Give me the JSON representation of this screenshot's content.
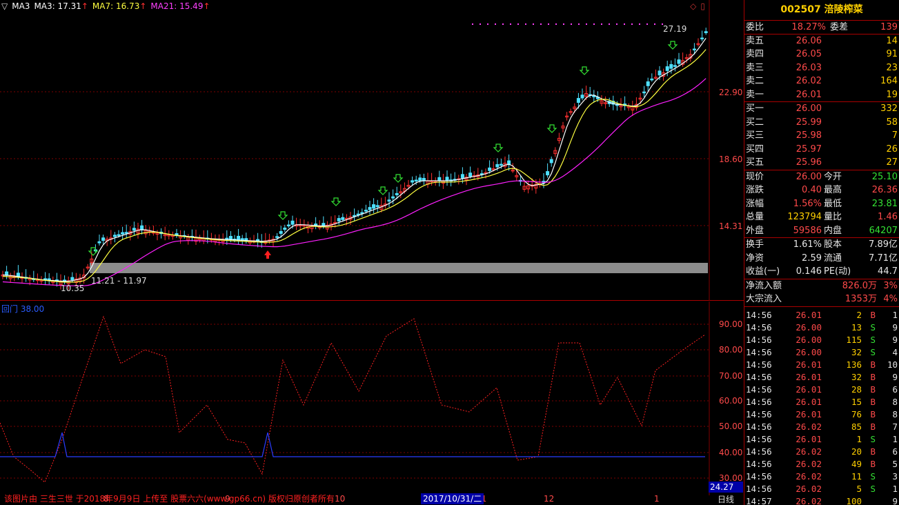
{
  "main": {
    "legend": {
      "ma3": "MA3: 17.31",
      "ma3_name": "MA3",
      "ma7": "MA7: 16.73",
      "ma21": "MA21: 15.49",
      "arrow": "↑"
    },
    "y_labels": [
      "22.90",
      "18.60",
      "14.31"
    ],
    "high_label": "27.19",
    "low_label": "10.35",
    "range_label": "11.21 - 11.97",
    "colors": {
      "up": "#ff3030",
      "down": "#4ee0ff",
      "ma3": "#ffffff",
      "ma7": "#ffff40",
      "ma21": "#ff20ff",
      "grid": "#800000"
    }
  },
  "indicator": {
    "legend": "回门 38.00",
    "y_labels": [
      "90.00",
      "80.00",
      "70.00",
      "60.00",
      "50.00",
      "40.00",
      "30.00"
    ],
    "value_box": "24.27"
  },
  "bottom": {
    "watermark": "该图片由 三生三世 于2018年9月9日 上传至 股票六六(www.gp66.cn) 版权归原创者所有",
    "date_box": "2017/10/31/二",
    "month_ticks": [
      "8",
      "9",
      "10",
      "11",
      "12",
      "1"
    ],
    "period": "日线"
  },
  "side": {
    "code": "002507",
    "name": "涪陵榨菜",
    "ratio_label": "委比",
    "ratio_value": "18.27%",
    "diff_label": "委差",
    "diff_value": "139",
    "sells": [
      {
        "label": "卖五",
        "price": "26.06",
        "vol": "14"
      },
      {
        "label": "卖四",
        "price": "26.05",
        "vol": "91"
      },
      {
        "label": "卖三",
        "price": "26.03",
        "vol": "23"
      },
      {
        "label": "卖二",
        "price": "26.02",
        "vol": "164"
      },
      {
        "label": "卖一",
        "price": "26.01",
        "vol": "19"
      }
    ],
    "buys": [
      {
        "label": "买一",
        "price": "26.00",
        "vol": "332"
      },
      {
        "label": "买二",
        "price": "25.99",
        "vol": "58"
      },
      {
        "label": "买三",
        "price": "25.98",
        "vol": "7"
      },
      {
        "label": "买四",
        "price": "25.97",
        "vol": "26"
      },
      {
        "label": "买五",
        "price": "25.96",
        "vol": "27"
      }
    ],
    "stats1": [
      {
        "l1": "现价",
        "v1": "26.00",
        "c1": "red",
        "l2": "今开",
        "v2": "25.10",
        "c2": "green"
      },
      {
        "l1": "涨跌",
        "v1": "0.40",
        "c1": "red",
        "l2": "最高",
        "v2": "26.36",
        "c2": "red"
      },
      {
        "l1": "涨幅",
        "v1": "1.56%",
        "c1": "red",
        "l2": "最低",
        "v2": "23.81",
        "c2": "green"
      },
      {
        "l1": "总量",
        "v1": "123794",
        "c1": "yellow",
        "l2": "量比",
        "v2": "1.46",
        "c2": "red"
      },
      {
        "l1": "外盘",
        "v1": "59586",
        "c1": "red",
        "l2": "内盘",
        "v2": "64207",
        "c2": "green"
      }
    ],
    "stats2": [
      {
        "l1": "换手",
        "v1": "1.61%",
        "c1": "white",
        "l2": "股本",
        "v2": "7.89亿",
        "c2": "white"
      },
      {
        "l1": "净资",
        "v1": "2.59",
        "c1": "white",
        "l2": "流通",
        "v2": "7.71亿",
        "c2": "white"
      },
      {
        "l1": "收益(一)",
        "v1": "0.146",
        "c1": "white",
        "l2": "PE(动)",
        "v2": "44.7",
        "c2": "white"
      }
    ],
    "flows": [
      {
        "label": "净流入额",
        "value": "826.0万",
        "pct": "3%"
      },
      {
        "label": "大宗流入",
        "value": "1353万",
        "pct": "4%"
      }
    ],
    "trades": [
      {
        "t": "14:56",
        "p": "26.01",
        "v": "2",
        "bs": "B",
        "n": "1"
      },
      {
        "t": "14:56",
        "p": "26.00",
        "v": "13",
        "bs": "S",
        "n": "9"
      },
      {
        "t": "14:56",
        "p": "26.00",
        "v": "115",
        "bs": "S",
        "n": "9"
      },
      {
        "t": "14:56",
        "p": "26.00",
        "v": "32",
        "bs": "S",
        "n": "4"
      },
      {
        "t": "14:56",
        "p": "26.01",
        "v": "136",
        "bs": "B",
        "n": "10"
      },
      {
        "t": "14:56",
        "p": "26.01",
        "v": "32",
        "bs": "B",
        "n": "9"
      },
      {
        "t": "14:56",
        "p": "26.01",
        "v": "28",
        "bs": "B",
        "n": "6"
      },
      {
        "t": "14:56",
        "p": "26.01",
        "v": "15",
        "bs": "B",
        "n": "8"
      },
      {
        "t": "14:56",
        "p": "26.01",
        "v": "76",
        "bs": "B",
        "n": "8"
      },
      {
        "t": "14:56",
        "p": "26.02",
        "v": "85",
        "bs": "B",
        "n": "7"
      },
      {
        "t": "14:56",
        "p": "26.01",
        "v": "1",
        "bs": "S",
        "n": "1"
      },
      {
        "t": "14:56",
        "p": "26.02",
        "v": "20",
        "bs": "B",
        "n": "6"
      },
      {
        "t": "14:56",
        "p": "26.02",
        "v": "49",
        "bs": "B",
        "n": "5"
      },
      {
        "t": "14:56",
        "p": "26.02",
        "v": "11",
        "bs": "S",
        "n": "3"
      },
      {
        "t": "14:56",
        "p": "26.02",
        "v": "5",
        "bs": "S",
        "n": "1"
      },
      {
        "t": "14:57",
        "p": "26.02",
        "v": "100",
        "bs": "",
        "n": "9"
      }
    ]
  }
}
